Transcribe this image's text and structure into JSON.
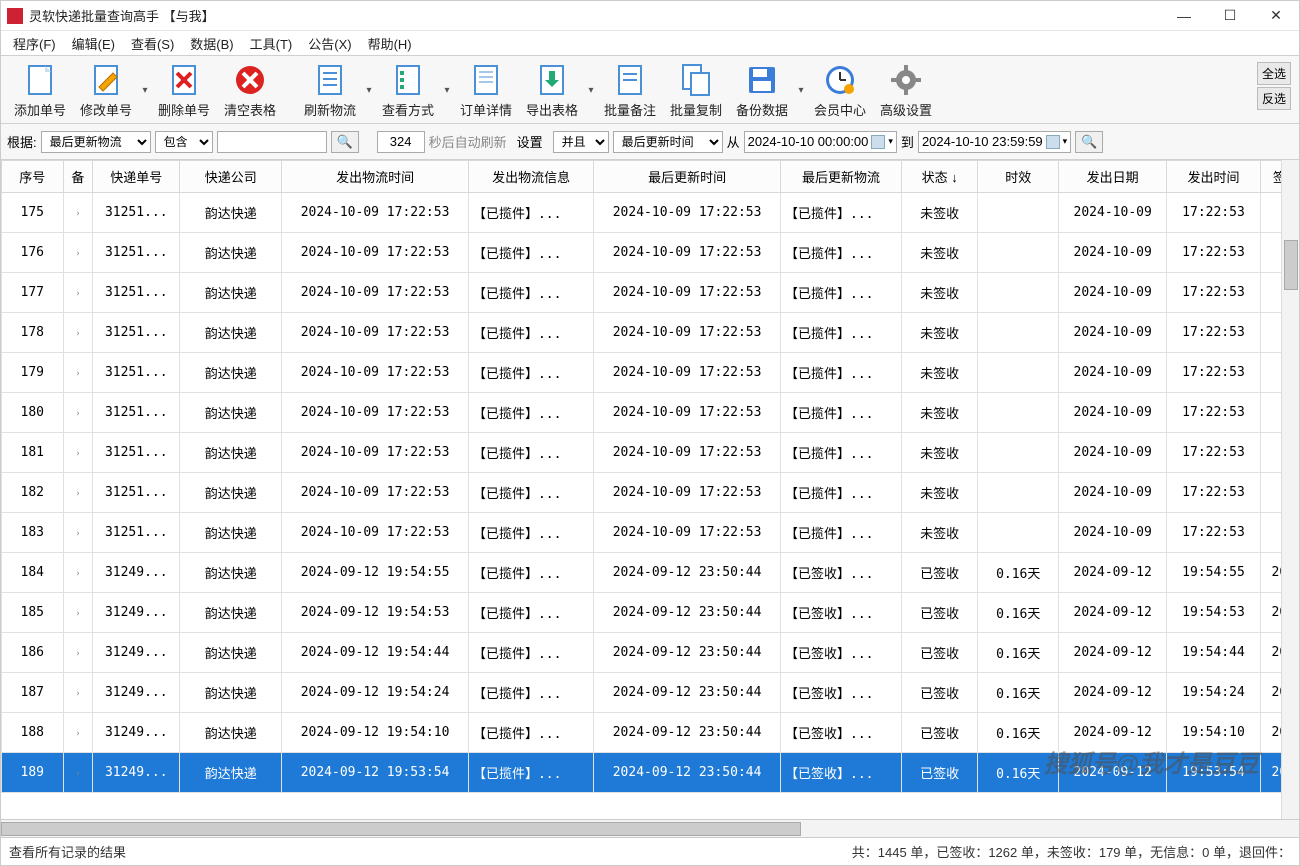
{
  "window": {
    "title": "灵软快递批量查询高手 【与我】"
  },
  "menus": [
    "程序(F)",
    "编辑(E)",
    "查看(S)",
    "数据(B)",
    "工具(T)",
    "公告(X)",
    "帮助(H)"
  ],
  "toolbar": {
    "add": "添加单号",
    "edit": "修改单号",
    "delete": "删除单号",
    "clear": "清空表格",
    "refresh": "刷新物流",
    "view": "查看方式",
    "detail": "订单详情",
    "export": "导出表格",
    "batchnote": "批量备注",
    "batchcopy": "批量复制",
    "backup": "备份数据",
    "member": "会员中心",
    "adv": "高级设置"
  },
  "sidebtn": {
    "selall": "全选",
    "invsel": "反选"
  },
  "filter": {
    "root_label": "根据:",
    "field1": "最后更新物流",
    "op": "包含",
    "count": "324",
    "autorefresh": "秒后自动刷新",
    "setting": "设置",
    "logic": "并且",
    "field2": "最后更新时间",
    "from_label": "从",
    "to_label": "到",
    "from": "2024-10-10 00:00:00",
    "to": "2024-10-10 23:59:59"
  },
  "columns": [
    "序号",
    "备",
    "快递单号",
    "快递公司",
    "发出物流时间",
    "发出物流信息",
    "最后更新时间",
    "最后更新物流",
    "状态 ↓",
    "时效",
    "发出日期",
    "发出时间",
    "签"
  ],
  "rows": [
    {
      "seq": "175",
      "no": "31251...",
      "co": "韵达快递",
      "sent": "2024-10-09 17:22:53",
      "info": "【已揽件】...",
      "upd": "2024-10-09 17:22:53",
      "updinfo": "【已揽件】...",
      "status": "未签收",
      "dur": "",
      "date": "2024-10-09",
      "time": "17:22:53",
      "sign": ""
    },
    {
      "seq": "176",
      "no": "31251...",
      "co": "韵达快递",
      "sent": "2024-10-09 17:22:53",
      "info": "【已揽件】...",
      "upd": "2024-10-09 17:22:53",
      "updinfo": "【已揽件】...",
      "status": "未签收",
      "dur": "",
      "date": "2024-10-09",
      "time": "17:22:53",
      "sign": ""
    },
    {
      "seq": "177",
      "no": "31251...",
      "co": "韵达快递",
      "sent": "2024-10-09 17:22:53",
      "info": "【已揽件】...",
      "upd": "2024-10-09 17:22:53",
      "updinfo": "【已揽件】...",
      "status": "未签收",
      "dur": "",
      "date": "2024-10-09",
      "time": "17:22:53",
      "sign": ""
    },
    {
      "seq": "178",
      "no": "31251...",
      "co": "韵达快递",
      "sent": "2024-10-09 17:22:53",
      "info": "【已揽件】...",
      "upd": "2024-10-09 17:22:53",
      "updinfo": "【已揽件】...",
      "status": "未签收",
      "dur": "",
      "date": "2024-10-09",
      "time": "17:22:53",
      "sign": ""
    },
    {
      "seq": "179",
      "no": "31251...",
      "co": "韵达快递",
      "sent": "2024-10-09 17:22:53",
      "info": "【已揽件】...",
      "upd": "2024-10-09 17:22:53",
      "updinfo": "【已揽件】...",
      "status": "未签收",
      "dur": "",
      "date": "2024-10-09",
      "time": "17:22:53",
      "sign": ""
    },
    {
      "seq": "180",
      "no": "31251...",
      "co": "韵达快递",
      "sent": "2024-10-09 17:22:53",
      "info": "【已揽件】...",
      "upd": "2024-10-09 17:22:53",
      "updinfo": "【已揽件】...",
      "status": "未签收",
      "dur": "",
      "date": "2024-10-09",
      "time": "17:22:53",
      "sign": ""
    },
    {
      "seq": "181",
      "no": "31251...",
      "co": "韵达快递",
      "sent": "2024-10-09 17:22:53",
      "info": "【已揽件】...",
      "upd": "2024-10-09 17:22:53",
      "updinfo": "【已揽件】...",
      "status": "未签收",
      "dur": "",
      "date": "2024-10-09",
      "time": "17:22:53",
      "sign": ""
    },
    {
      "seq": "182",
      "no": "31251...",
      "co": "韵达快递",
      "sent": "2024-10-09 17:22:53",
      "info": "【已揽件】...",
      "upd": "2024-10-09 17:22:53",
      "updinfo": "【已揽件】...",
      "status": "未签收",
      "dur": "",
      "date": "2024-10-09",
      "time": "17:22:53",
      "sign": ""
    },
    {
      "seq": "183",
      "no": "31251...",
      "co": "韵达快递",
      "sent": "2024-10-09 17:22:53",
      "info": "【已揽件】...",
      "upd": "2024-10-09 17:22:53",
      "updinfo": "【已揽件】...",
      "status": "未签收",
      "dur": "",
      "date": "2024-10-09",
      "time": "17:22:53",
      "sign": ""
    },
    {
      "seq": "184",
      "no": "31249...",
      "co": "韵达快递",
      "sent": "2024-09-12 19:54:55",
      "info": "【已揽件】...",
      "upd": "2024-09-12 23:50:44",
      "updinfo": "【已签收】...",
      "status": "已签收",
      "dur": "0.16天",
      "date": "2024-09-12",
      "time": "19:54:55",
      "sign": "20"
    },
    {
      "seq": "185",
      "no": "31249...",
      "co": "韵达快递",
      "sent": "2024-09-12 19:54:53",
      "info": "【已揽件】...",
      "upd": "2024-09-12 23:50:44",
      "updinfo": "【已签收】...",
      "status": "已签收",
      "dur": "0.16天",
      "date": "2024-09-12",
      "time": "19:54:53",
      "sign": "20"
    },
    {
      "seq": "186",
      "no": "31249...",
      "co": "韵达快递",
      "sent": "2024-09-12 19:54:44",
      "info": "【已揽件】...",
      "upd": "2024-09-12 23:50:44",
      "updinfo": "【已签收】...",
      "status": "已签收",
      "dur": "0.16天",
      "date": "2024-09-12",
      "time": "19:54:44",
      "sign": "20"
    },
    {
      "seq": "187",
      "no": "31249...",
      "co": "韵达快递",
      "sent": "2024-09-12 19:54:24",
      "info": "【已揽件】...",
      "upd": "2024-09-12 23:50:44",
      "updinfo": "【已签收】...",
      "status": "已签收",
      "dur": "0.16天",
      "date": "2024-09-12",
      "time": "19:54:24",
      "sign": "20"
    },
    {
      "seq": "188",
      "no": "31249...",
      "co": "韵达快递",
      "sent": "2024-09-12 19:54:10",
      "info": "【已揽件】...",
      "upd": "2024-09-12 23:50:44",
      "updinfo": "【已签收】...",
      "status": "已签收",
      "dur": "0.16天",
      "date": "2024-09-12",
      "time": "19:54:10",
      "sign": "20"
    },
    {
      "seq": "189",
      "no": "31249...",
      "co": "韵达快递",
      "sent": "2024-09-12 19:53:54",
      "info": "【已揽件】...",
      "upd": "2024-09-12 23:50:44",
      "updinfo": "【已签收】...",
      "status": "已签收",
      "dur": "0.16天",
      "date": "2024-09-12",
      "time": "19:53:54",
      "sign": "20",
      "selected": true
    }
  ],
  "status": {
    "left": "查看所有记录的结果",
    "right": "共：1445 单，已签收：1262 单，未签收：179 单，无信息：0 单，退回件："
  },
  "watermark": "搜狐号@我才是豆豆"
}
